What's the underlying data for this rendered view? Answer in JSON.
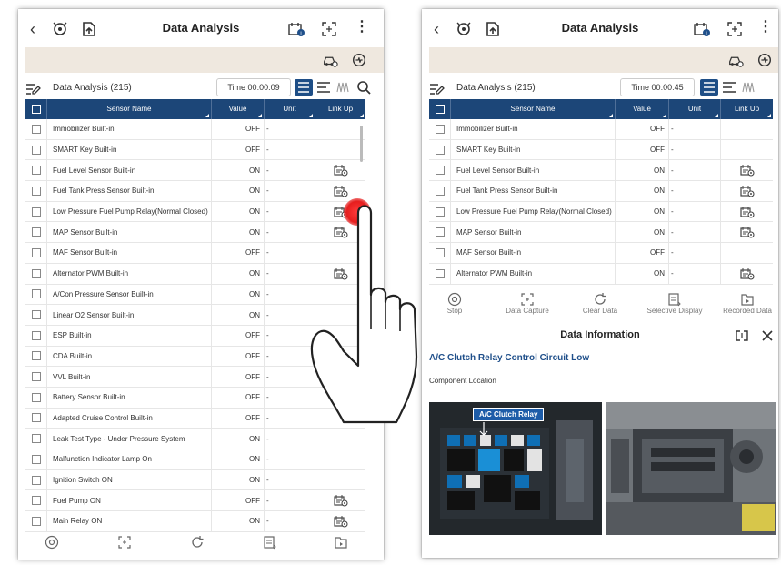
{
  "left": {
    "title": "Data Analysis",
    "list_label": "Data Analysis (215)",
    "time": "Time 00:00:09",
    "columns": [
      "Sensor Name",
      "Value",
      "Unit",
      "Link Up"
    ],
    "rows": [
      {
        "name": "Immobilizer Built-in",
        "value": "OFF",
        "unit": "-",
        "link": false
      },
      {
        "name": "SMART Key Built-in",
        "value": "OFF",
        "unit": "-",
        "link": false
      },
      {
        "name": "Fuel Level Sensor Built-in",
        "value": "ON",
        "unit": "-",
        "link": true
      },
      {
        "name": "Fuel Tank Press Sensor Built-in",
        "value": "ON",
        "unit": "-",
        "link": true
      },
      {
        "name": "Low Pressure Fuel Pump Relay(Normal Closed)",
        "value": "ON",
        "unit": "-",
        "link": true
      },
      {
        "name": "MAP Sensor Built-in",
        "value": "ON",
        "unit": "-",
        "link": true
      },
      {
        "name": "MAF Sensor Built-in",
        "value": "OFF",
        "unit": "-",
        "link": false
      },
      {
        "name": "Alternator PWM Built-in",
        "value": "ON",
        "unit": "-",
        "link": true
      },
      {
        "name": "A/Con Pressure Sensor Built-in",
        "value": "ON",
        "unit": "-",
        "link": false
      },
      {
        "name": "Linear O2 Sensor Built-in",
        "value": "ON",
        "unit": "-",
        "link": false
      },
      {
        "name": "ESP Built-in",
        "value": "OFF",
        "unit": "-",
        "link": false
      },
      {
        "name": "CDA Built-in",
        "value": "OFF",
        "unit": "-",
        "link": false
      },
      {
        "name": "VVL Built-in",
        "value": "OFF",
        "unit": "-",
        "link": false
      },
      {
        "name": "Battery Sensor Built-in",
        "value": "OFF",
        "unit": "-",
        "link": true
      },
      {
        "name": "Adapted Cruise Control Built-in",
        "value": "OFF",
        "unit": "-",
        "link": false
      },
      {
        "name": "Leak Test Type - Under Pressure System",
        "value": "ON",
        "unit": "-",
        "link": false
      },
      {
        "name": "Malfunction Indicator Lamp On",
        "value": "ON",
        "unit": "-",
        "link": false
      },
      {
        "name": "Ignition Switch ON",
        "value": "ON",
        "unit": "-",
        "link": false
      },
      {
        "name": "Fuel Pump ON",
        "value": "OFF",
        "unit": "-",
        "link": true
      },
      {
        "name": "Main Relay ON",
        "value": "ON",
        "unit": "-",
        "link": true
      }
    ]
  },
  "right": {
    "title": "Data Analysis",
    "list_label": "Data Analysis (215)",
    "time": "Time 00:00:45",
    "columns": [
      "Sensor Name",
      "Value",
      "Unit",
      "Link Up"
    ],
    "rows": [
      {
        "name": "Immobilizer Built-in",
        "value": "OFF",
        "unit": "-",
        "link": false
      },
      {
        "name": "SMART Key Built-in",
        "value": "OFF",
        "unit": "-",
        "link": false
      },
      {
        "name": "Fuel Level Sensor Built-in",
        "value": "ON",
        "unit": "-",
        "link": true
      },
      {
        "name": "Fuel Tank Press Sensor Built-in",
        "value": "ON",
        "unit": "-",
        "link": true
      },
      {
        "name": "Low Pressure Fuel Pump Relay(Normal Closed)",
        "value": "ON",
        "unit": "-",
        "link": true
      },
      {
        "name": "MAP Sensor Built-in",
        "value": "ON",
        "unit": "-",
        "link": true
      },
      {
        "name": "MAF Sensor Built-in",
        "value": "OFF",
        "unit": "-",
        "link": false
      },
      {
        "name": "Alternator PWM Built-in",
        "value": "ON",
        "unit": "-",
        "link": true
      }
    ],
    "toolbar": [
      "Stop",
      "Data Capture",
      "Clear Data",
      "Selective Display",
      "Recorded Data"
    ],
    "panel_title": "Data Information",
    "panel_heading": "A/C Clutch Relay Control Circuit Low",
    "panel_sub": "Component Location",
    "photo_label": "A/C Clutch Relay"
  },
  "colors": {
    "header_blue": "#1c4678",
    "accent_blue": "#1f4f8a",
    "band": "#efe8df",
    "tap": "#e61e1e"
  }
}
